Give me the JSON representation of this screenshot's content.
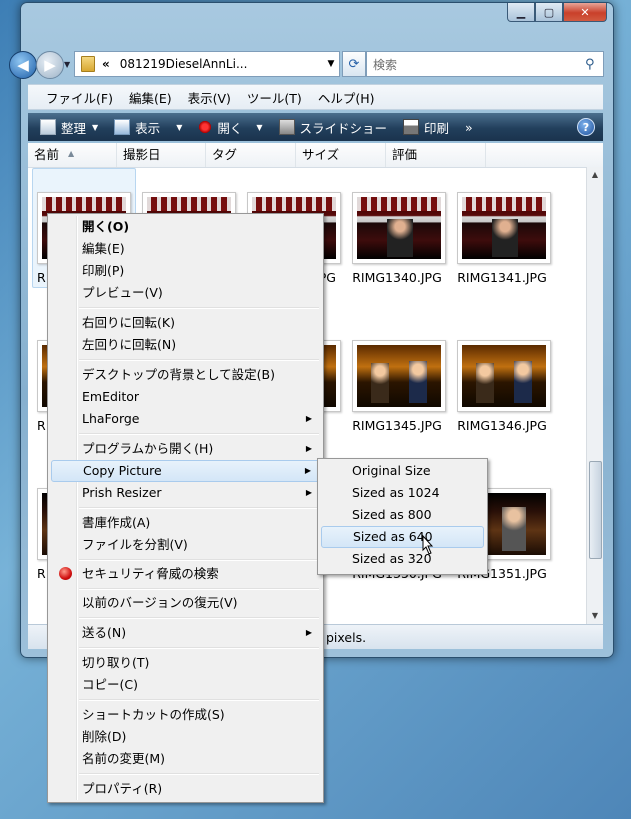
{
  "window": {
    "address": {
      "chevron": "«",
      "path": "081219DieselAnnLi..."
    },
    "search": {
      "placeholder": "検索"
    },
    "menubar": [
      "ファイル(F)",
      "編集(E)",
      "表示(V)",
      "ツール(T)",
      "ヘルプ(H)"
    ],
    "toolbar": {
      "organize": "整理",
      "views": "表示",
      "open": "開く",
      "slideshow": "スライドショー",
      "print": "印刷",
      "more": "»"
    },
    "columns": [
      "名前",
      "撮影日",
      "タグ",
      "サイズ",
      "評価"
    ],
    "files": {
      "r1": [
        "R",
        "",
        "JPG",
        "RIMG1340.JPG",
        "RIMG1341.JPG"
      ],
      "r2": [
        "R",
        "",
        "JPG",
        "RIMG1345.JPG",
        "RIMG1346.JPG"
      ],
      "r3": [
        "R",
        "",
        "",
        "RIMG1350.JPG",
        "RIMG1351.JPG"
      ]
    },
    "status_text": "pixels."
  },
  "context_menu": {
    "open": "開く(O)",
    "edit": "編集(E)",
    "print": "印刷(P)",
    "preview": "プレビュー(V)",
    "rotate_cw": "右回りに回転(K)",
    "rotate_ccw": "左回りに回転(N)",
    "set_desktop": "デスクトップの背景として設定(B)",
    "emeditor": "EmEditor",
    "lhaforge": "LhaForge",
    "open_with": "プログラムから開く(H)",
    "copy_picture": "Copy Picture",
    "prish_resizer": "Prish Resizer",
    "create_archive": "書庫作成(A)",
    "split_file": "ファイルを分割(V)",
    "security_scan": "セキュリティ脅威の検索",
    "restore_versions": "以前のバージョンの復元(V)",
    "send_to": "送る(N)",
    "cut": "切り取り(T)",
    "copy": "コピー(C)",
    "create_shortcut": "ショートカットの作成(S)",
    "delete": "削除(D)",
    "rename": "名前の変更(M)",
    "properties": "プロパティ(R)"
  },
  "submenu": {
    "items": [
      "Original Size",
      "Sized as 1024",
      "Sized as 800",
      "Sized as 640",
      "Sized as 320"
    ],
    "highlighted": "Sized as 640"
  }
}
